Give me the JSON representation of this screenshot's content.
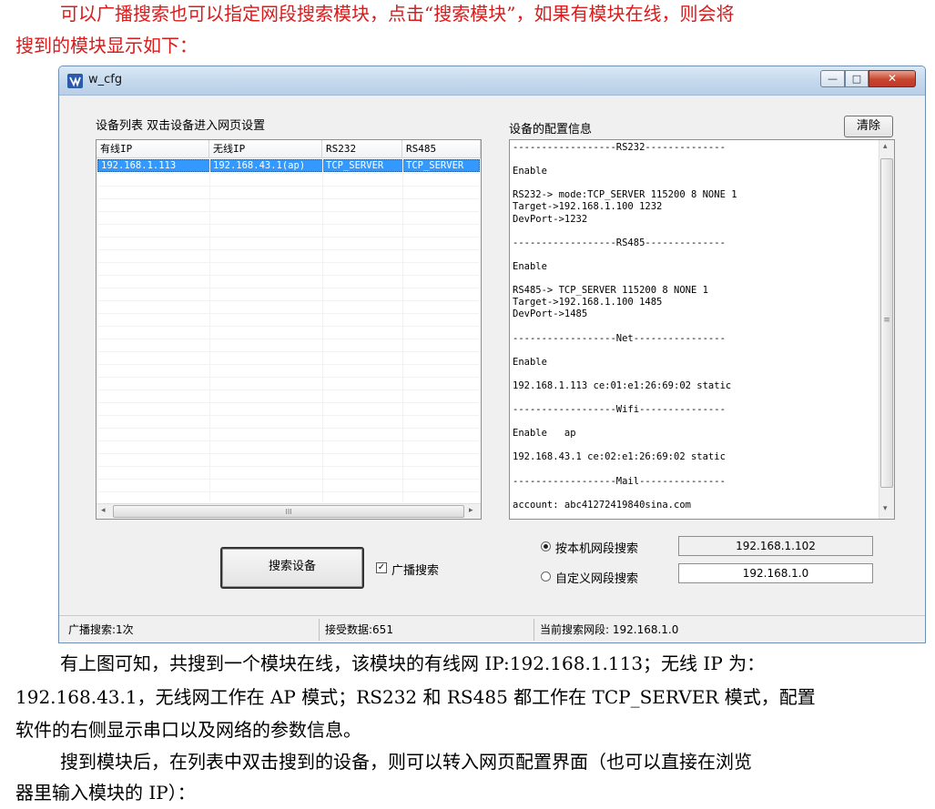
{
  "doc": {
    "intro_line1": "可以广播搜索也可以指定网段搜索模块，点击“搜索模块”，如果有模块在线，则会将",
    "intro_line2": "搜到的模块显示如下：",
    "para1_line1": "有上图可知，共搜到一个模块在线，该模块的有线网 IP:192.168.1.113；无线 IP 为：",
    "para1_line2": "192.168.43.1，无线网工作在 AP 模式；RS232 和 RS485 都工作在 TCP_SERVER 模式，配置",
    "para1_line3": "软件的右侧显示串口以及网络的参数信息。",
    "para2_line1": "搜到模块后，在列表中双击搜到的设备，则可以转入网页配置界面（也可以直接在浏览",
    "para2_line2": "器里输入模块的 IP）："
  },
  "window": {
    "title": "w_cfg",
    "min_glyph": "—",
    "max_glyph": "□",
    "close_glyph": "✕",
    "icon": "app-icon"
  },
  "device_list": {
    "label": "设备列表 双击设备进入网页设置",
    "columns": [
      "有线IP",
      "无线IP",
      "RS232",
      "RS485"
    ],
    "rows": [
      [
        "192.168.1.113",
        "192.168.43.1(ap)",
        "TCP_SERVER",
        "TCP_SERVER"
      ]
    ],
    "scroll_left": "◂",
    "scroll_right": "▸",
    "thumb_grip": "III"
  },
  "config": {
    "label": "设备的配置信息",
    "clear_button": "清除",
    "text": "------------------RS232--------------\n\nEnable\n\nRS232-> mode:TCP_SERVER 115200 8 NONE 1\nTarget->192.168.1.100 1232\nDevPort->1232\n\n------------------RS485--------------\n\nEnable\n\nRS485-> TCP_SERVER 115200 8 NONE 1\nTarget->192.168.1.100 1485\nDevPort->1485\n\n------------------Net----------------\n\nEnable\n\n192.168.1.113 ce:01:e1:26:69:02 static\n\n------------------Wifi---------------\n\nEnable   ap\n\n192.168.43.1 ce:02:e1:26:69:02 static\n\n------------------Mail---------------\n\naccount: abc41272419840sina.com",
    "scroll_up": "▴",
    "scroll_down": "▾",
    "thumb_grip": "≡"
  },
  "controls": {
    "search_button": "搜索设备",
    "broadcast_check": "✓",
    "broadcast_label": "广播搜索",
    "broadcast_checked": true,
    "radio_local_label": "按本机网段搜索",
    "radio_local_selected": true,
    "radio_custom_label": "自定义网段搜索",
    "radio_custom_selected": false,
    "local_segment": "192.168.1.102",
    "custom_segment": "192.168.1.0"
  },
  "status": {
    "broadcast": "广播搜索:1次",
    "received": "接受数据:651",
    "current_segment": "当前搜索网段: 192.168.1.0"
  },
  "colors": {
    "heading_red": "#d81b1b",
    "selection_blue": "#3399ff"
  }
}
